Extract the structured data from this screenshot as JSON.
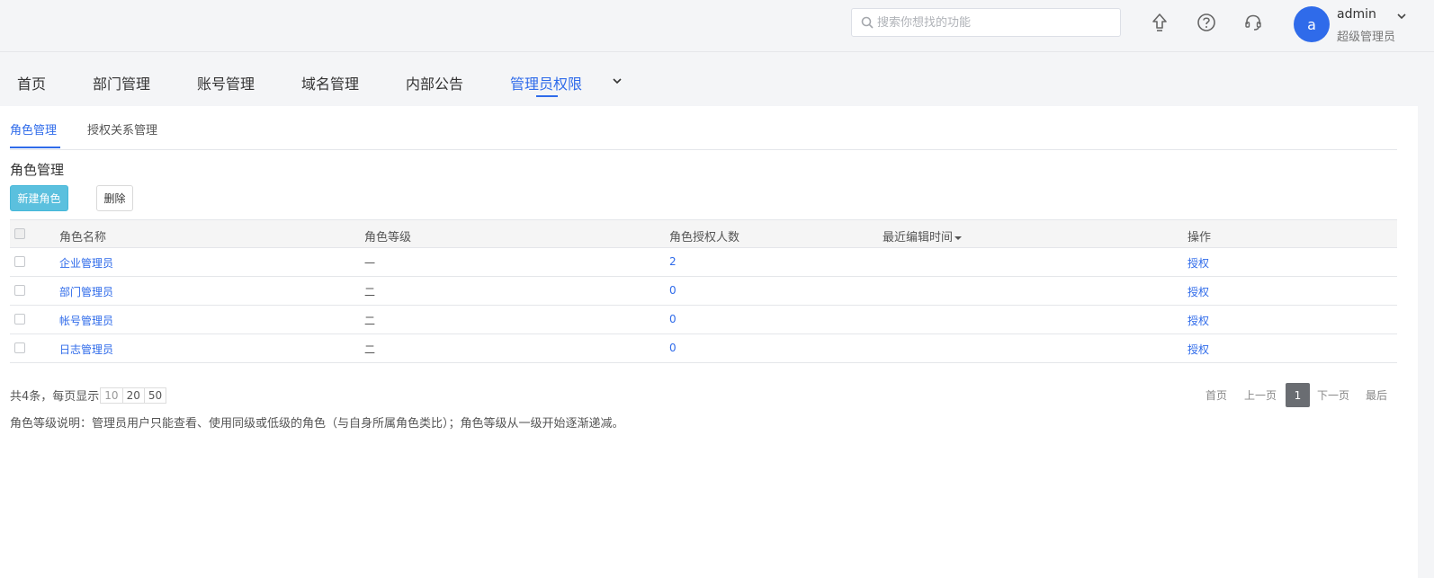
{
  "header": {
    "search_placeholder": "搜索你想找的功能",
    "user": {
      "avatar_letter": "a",
      "name": "admin",
      "role": "超级管理员"
    },
    "accent_color": "#2f6bea"
  },
  "nav": {
    "items": [
      "首页",
      "部门管理",
      "账号管理",
      "域名管理",
      "内部公告",
      "管理员权限"
    ],
    "active_index": 5
  },
  "subtabs": {
    "items": [
      "角色管理",
      "授权关系管理"
    ],
    "active_index": 0
  },
  "section": {
    "title": "角色管理",
    "new_button": "新建角色",
    "delete_button": "删除"
  },
  "table": {
    "headers": [
      "角色名称",
      "角色等级",
      "角色授权人数",
      "最近编辑时间",
      "操作"
    ],
    "rows": [
      {
        "name": "企业管理员",
        "level": "一",
        "count": "2",
        "edited": "",
        "action": "授权"
      },
      {
        "name": "部门管理员",
        "level": "二",
        "count": "0",
        "edited": "",
        "action": "授权"
      },
      {
        "name": "帐号管理员",
        "level": "二",
        "count": "0",
        "edited": "",
        "action": "授权"
      },
      {
        "name": "日志管理员",
        "level": "二",
        "count": "0",
        "edited": "",
        "action": "授权"
      }
    ]
  },
  "footer": {
    "total_text": "共4条，每页显示",
    "page_sizes": [
      "10",
      "20",
      "50"
    ],
    "note": "角色等级说明：管理员用户只能查看、使用同级或低级的角色（与自身所属角色类比）；角色等级从一级开始逐渐递减。"
  },
  "pager": {
    "first": "首页",
    "prev": "上一页",
    "current": "1",
    "next": "下一页",
    "last": "最后"
  }
}
